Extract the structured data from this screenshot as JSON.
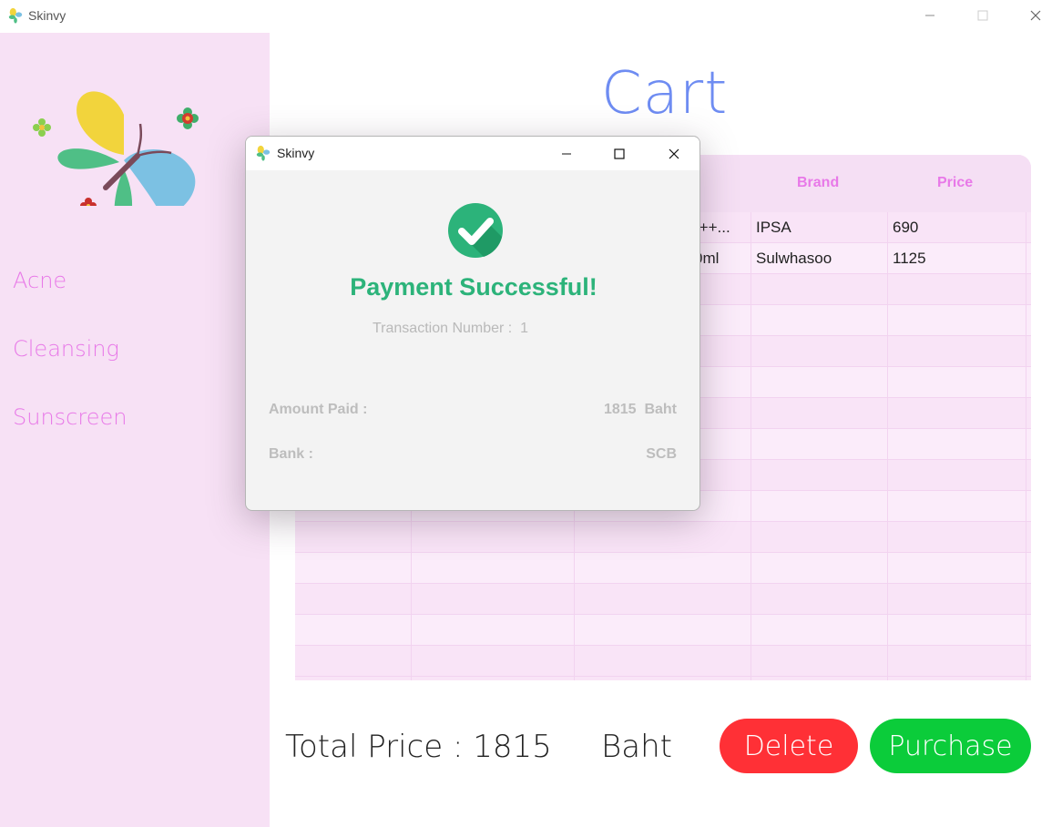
{
  "window": {
    "title": "Skinvy"
  },
  "sidebar": {
    "items": [
      {
        "label": "Acne"
      },
      {
        "label": "Cleansing"
      },
      {
        "label": "Sunscreen"
      }
    ]
  },
  "main": {
    "title": "Cart",
    "table": {
      "headers": [
        "Brand",
        "Price"
      ],
      "rows": [
        {
          "name_fragment": "-++...",
          "brand": "IPSA",
          "price": "690"
        },
        {
          "name_fragment": "0ml",
          "brand": "Sulwhasoo",
          "price": "1125"
        }
      ]
    },
    "total_label": "Total Price : 1815",
    "currency": "Baht",
    "delete_label": "Delete",
    "purchase_label": "Purchase"
  },
  "dialog": {
    "title": "Skinvy",
    "heading": "Payment Successful!",
    "transaction": "Transaction Number :  1",
    "amount_label": "Amount Paid :",
    "amount_value": "1815  Baht",
    "bank_label": "Bank :",
    "bank_value": "SCB"
  },
  "colors": {
    "sidebar_bg": "#f7e1f5",
    "accent_pink": "#e879e8",
    "title_blue": "#6e8cf2",
    "delete_red": "#ff3036",
    "purchase_green": "#0bcc3a",
    "success_green": "#2cb37a"
  }
}
